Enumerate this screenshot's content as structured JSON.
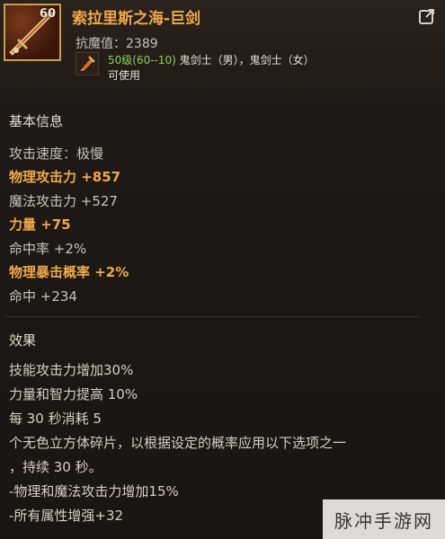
{
  "item": {
    "level": "60",
    "name": "索拉里斯之海-巨剑",
    "anti_magic": "抗魔值：2389",
    "req_level": "50级(60--10)",
    "req_jobs": " 鬼剑士（男），鬼剑士（女）",
    "usable": "可使用"
  },
  "basic_info": {
    "title": "基本信息",
    "stats": [
      {
        "text": "攻击速度：极慢",
        "highlight": false
      },
      {
        "text": "物理攻击力 +857",
        "highlight": true
      },
      {
        "text": "魔法攻击力 +527",
        "highlight": false
      },
      {
        "text": "力量 +75",
        "highlight": true
      },
      {
        "text": "命中率 +2%",
        "highlight": false
      },
      {
        "text": "物理暴击概率 +2%",
        "highlight": true
      },
      {
        "text": "命中 +234",
        "highlight": false
      }
    ]
  },
  "effects": {
    "title": "效果",
    "lines": [
      "技能攻击力增加30%",
      "力量和智力提高 10%",
      "每 30 秒消耗 5",
      "个无色立方体碎片，以根据设定的概率应用以下选项之一",
      "，持续 30 秒。",
      "-物理和魔法攻击力增加15%",
      "-所有属性增强+32"
    ]
  },
  "watermark": "脉冲手游网",
  "colors": {
    "highlight": "#f0a94a",
    "level_req": "#8cd15a",
    "icon_border": "#c9a04a"
  },
  "icons": [
    "sword-item-icon",
    "share-icon",
    "job-class-icon"
  ]
}
